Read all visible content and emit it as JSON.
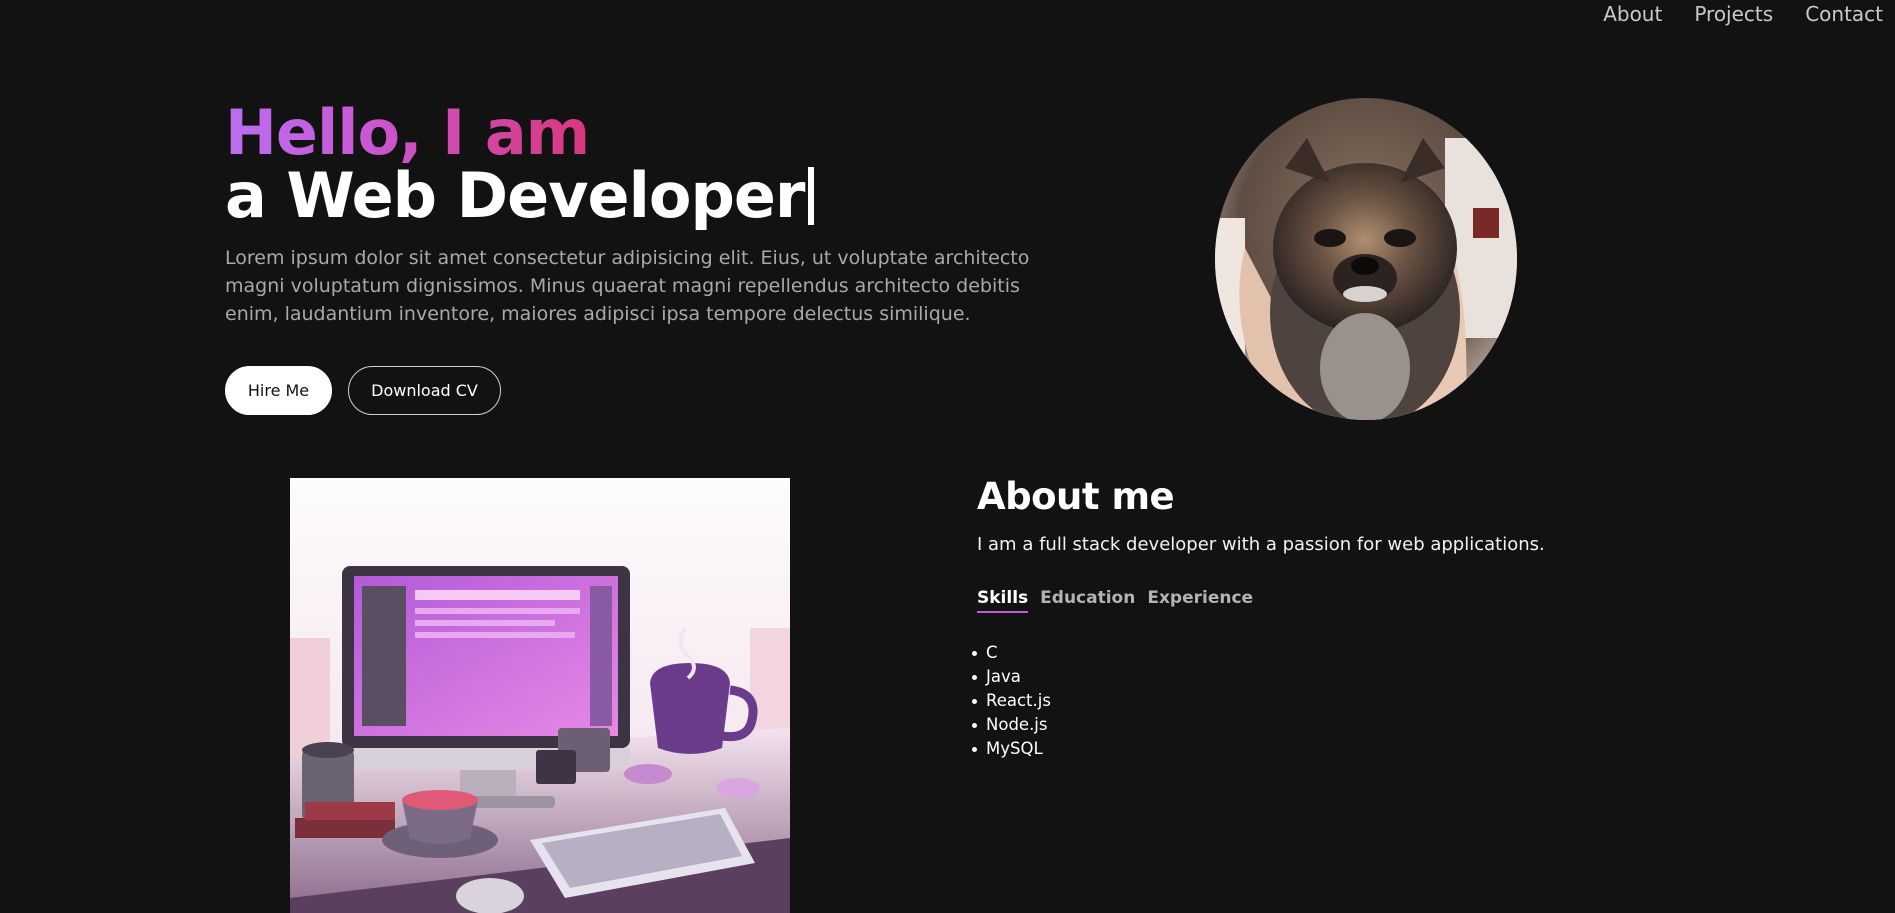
{
  "nav": {
    "items": [
      {
        "label": "About"
      },
      {
        "label": "Projects"
      },
      {
        "label": "Contact"
      }
    ]
  },
  "hero": {
    "greeting": "Hello, I am",
    "role": "a Web Developer",
    "intro": "Lorem ipsum dolor sit amet consectetur adipisicing elit. Eius, ut voluptate architecto magni voluptatum dignissimos. Minus quaerat magni repellendus architecto debitis enim, laudantium inventore, maiores adipisci ipsa tempore delectus similique.",
    "hire_label": "Hire Me",
    "cv_label": "Download CV"
  },
  "about": {
    "title": "About me",
    "description": "I am a full stack developer with a passion for web applications.",
    "tabs": [
      {
        "label": "Skills",
        "active": true
      },
      {
        "label": "Education",
        "active": false
      },
      {
        "label": "Experience",
        "active": false
      }
    ],
    "skills": [
      "C",
      "Java",
      "React.js",
      "Node.js",
      "MySQL"
    ]
  },
  "colors": {
    "background": "#121212",
    "gradient_start": "#b96ff0",
    "gradient_end": "#d8387c",
    "tab_underline": "#c25bd6"
  }
}
